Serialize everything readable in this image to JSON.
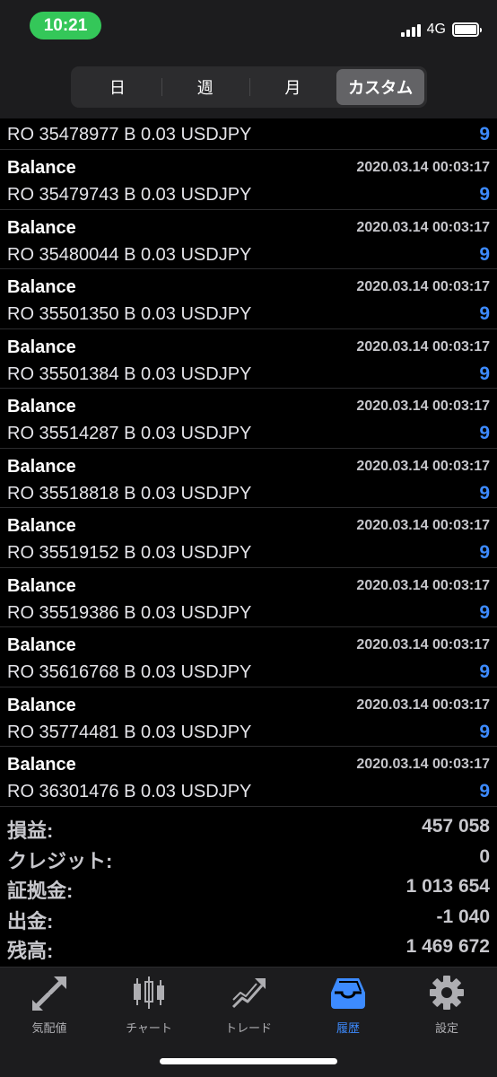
{
  "status_bar": {
    "time": "10:21",
    "network": "4G",
    "time_pill_color": "#34c759"
  },
  "segments": [
    {
      "label": "日",
      "active": false
    },
    {
      "label": "週",
      "active": false
    },
    {
      "label": "月",
      "active": false
    },
    {
      "label": "カスタム",
      "active": true
    }
  ],
  "first_row": {
    "description": "RO 35478977 B 0.03 USDJPY",
    "amount": "9"
  },
  "rows": [
    {
      "type": "Balance",
      "date": "2020.03.14 00:03:17",
      "description": "RO 35479743 B 0.03 USDJPY",
      "amount": "9"
    },
    {
      "type": "Balance",
      "date": "2020.03.14 00:03:17",
      "description": "RO 35480044 B 0.03 USDJPY",
      "amount": "9"
    },
    {
      "type": "Balance",
      "date": "2020.03.14 00:03:17",
      "description": "RO 35501350 B 0.03 USDJPY",
      "amount": "9"
    },
    {
      "type": "Balance",
      "date": "2020.03.14 00:03:17",
      "description": "RO 35501384 B 0.03 USDJPY",
      "amount": "9"
    },
    {
      "type": "Balance",
      "date": "2020.03.14 00:03:17",
      "description": "RO 35514287 B 0.03 USDJPY",
      "amount": "9"
    },
    {
      "type": "Balance",
      "date": "2020.03.14 00:03:17",
      "description": "RO 35518818 B 0.03 USDJPY",
      "amount": "9"
    },
    {
      "type": "Balance",
      "date": "2020.03.14 00:03:17",
      "description": "RO 35519152 B 0.03 USDJPY",
      "amount": "9"
    },
    {
      "type": "Balance",
      "date": "2020.03.14 00:03:17",
      "description": "RO 35519386 B 0.03 USDJPY",
      "amount": "9"
    },
    {
      "type": "Balance",
      "date": "2020.03.14 00:03:17",
      "description": "RO 35616768 B 0.03 USDJPY",
      "amount": "9"
    },
    {
      "type": "Balance",
      "date": "2020.03.14 00:03:17",
      "description": "RO 35774481 B 0.03 USDJPY",
      "amount": "9"
    },
    {
      "type": "Balance",
      "date": "2020.03.14 00:03:17",
      "description": "RO 36301476 B 0.03 USDJPY",
      "amount": "9"
    }
  ],
  "summary": [
    {
      "label": "損益:",
      "value": "457 058"
    },
    {
      "label": "クレジット:",
      "value": "0"
    },
    {
      "label": "証拠金:",
      "value": "1 013 654"
    },
    {
      "label": "出金:",
      "value": "-1 040"
    },
    {
      "label": "残高:",
      "value": "1 469 672"
    }
  ],
  "tabs": [
    {
      "label": "気配値",
      "icon": "quotes-arrows-icon",
      "active": false
    },
    {
      "label": "チャート",
      "icon": "candlestick-chart-icon",
      "active": false
    },
    {
      "label": "トレード",
      "icon": "trade-trend-icon",
      "active": false
    },
    {
      "label": "履歴",
      "icon": "history-inbox-icon",
      "active": true
    },
    {
      "label": "設定",
      "icon": "gear-icon",
      "active": false
    }
  ],
  "colors": {
    "accent": "#3d8bff",
    "background": "#000000",
    "header": "#1c1c1e",
    "muted_text": "#c7c7cc"
  }
}
